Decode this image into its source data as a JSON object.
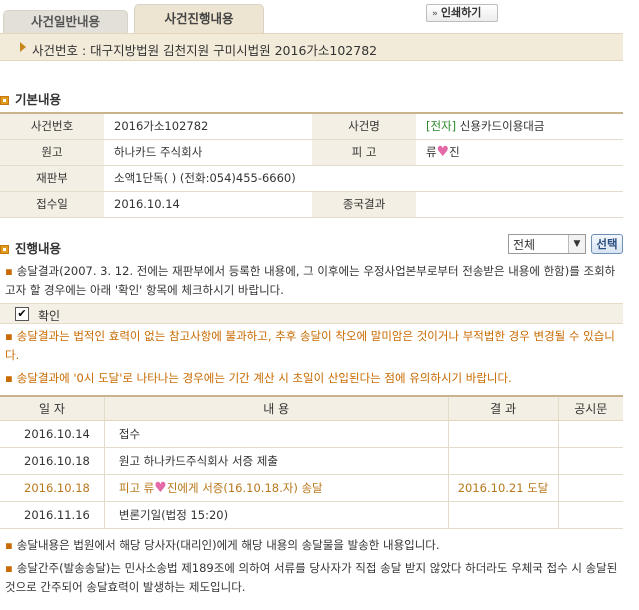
{
  "tabs": {
    "general": "사건일반내용",
    "progress": "사건진행내용"
  },
  "print_button": "인쇄하기",
  "case_header": "사건번호 : 대구지방법원 김천지원 구미시법원 2016가소102782",
  "basic_info": {
    "title": "기본내용",
    "rows": [
      {
        "h1": "사건번호",
        "v1": "2016가소102782",
        "h2": "사건명",
        "v2_tag": "[전자]",
        "v2": "신용카드이용대금"
      },
      {
        "h1": "원고",
        "v1": "하나카드 주식회사",
        "h2": "피 고",
        "v2_pre": "류",
        "v2_post": "진"
      },
      {
        "h1": "재판부",
        "v1": "소액1단독( ) (전화:054)455-6660)"
      },
      {
        "h1": "접수일",
        "v1": "2016.10.14",
        "h2": "종국결과",
        "v2": ""
      }
    ]
  },
  "progress": {
    "title": "진행내용",
    "filter_value": "전체",
    "select_button": "선택",
    "note1": "송달결과(2007. 3. 12. 전에는 재판부에서 등록한 내용에, 그 이후에는 우정사업본부로부터 전송받은 내용에 한함)를 조회하고자 할 경우에는 아래 '확인' 항목에 체크하시기 바랍니다.",
    "confirm_label": "확인",
    "note2": "송달결과는 법적인 효력이 없는 참고사항에 불과하고, 추후 송달이 착오에 말미암은 것이거나 부적법한 경우 변경될 수 있습니다.",
    "note3": "송달결과에 '0시 도달'로 나타나는 경우에는 기간 계산 시 초일이 산입된다는 점에 유의하시기 바랍니다.",
    "columns": [
      "일 자",
      "내 용",
      "결 과",
      "공시문"
    ],
    "rows": [
      {
        "date": "2016.10.14",
        "content": "접수",
        "result": ""
      },
      {
        "date": "2016.10.18",
        "content": "원고 하나카드주식회사 서증 제출",
        "result": ""
      },
      {
        "date": "2016.10.18",
        "content_pre": "피고 류",
        "content_post": "진에게 서증(16.10.18.자) 송달",
        "result": "2016.10.21 도달"
      },
      {
        "date": "2016.11.16",
        "content": "변론기일(법정 15:20)",
        "result": ""
      }
    ]
  },
  "footer_notes": [
    "송달내용은 법원에서 해당 당사자(대리인)에게 해당 내용의 송달물을 발송한 내용입니다.",
    "송달간주(발송송달)는 민사소송법 제189조에 의하여 서류를 당사자가 직접 송달 받지 않았다 하더라도 우체국 접수 시 송달된 것으로 간주되어 송달효력이 발생하는 제도입니다."
  ],
  "colors": {
    "accent_orange": "#c86a00",
    "header_bg": "#f3ebd9",
    "electronic_tag": "#2b8a2b"
  }
}
